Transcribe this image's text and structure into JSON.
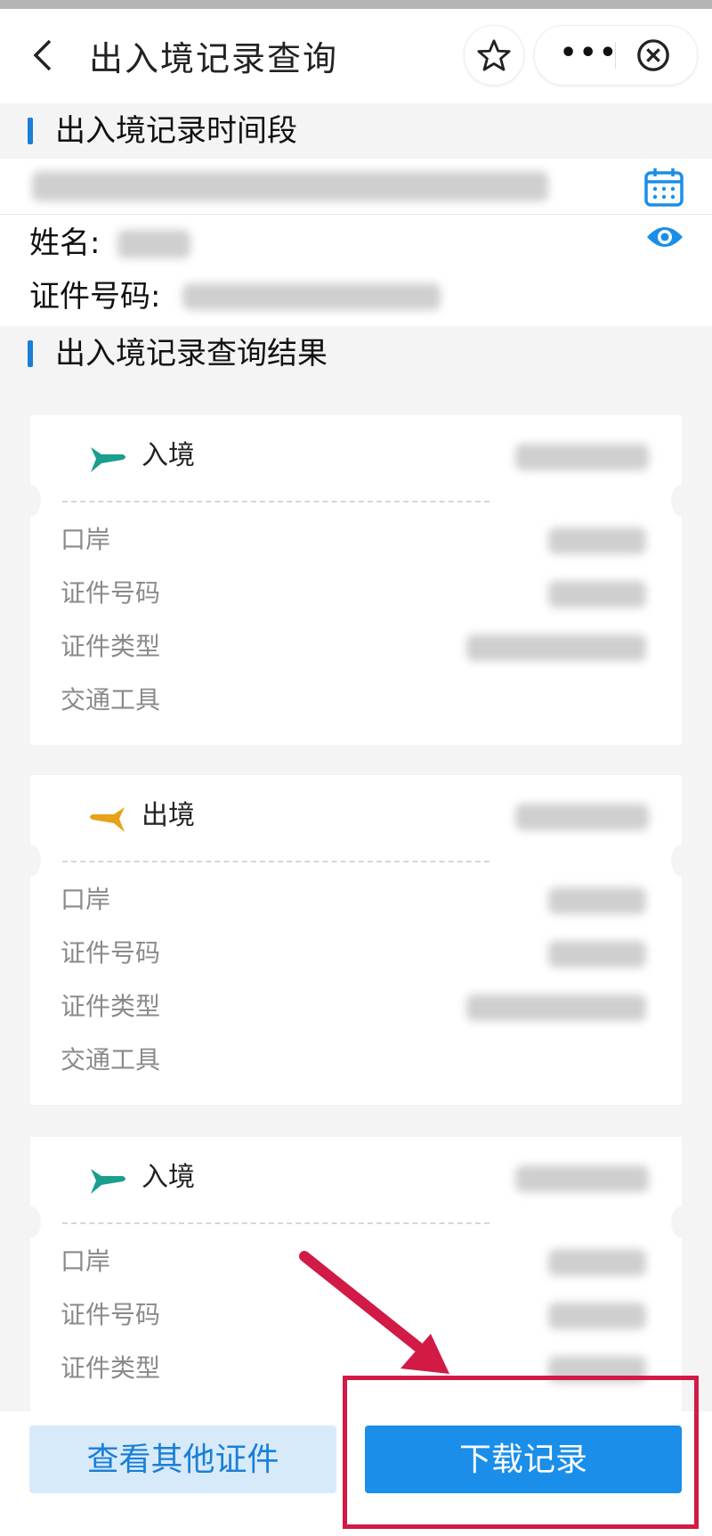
{
  "header": {
    "title": "出入境记录查询"
  },
  "period_section": {
    "title": "出入境记录时间段"
  },
  "person": {
    "name_label": "姓名:",
    "id_label": "证件号码:"
  },
  "results_section": {
    "title": "出入境记录查询结果"
  },
  "records": [
    {
      "type": "入境",
      "direction": "entry"
    },
    {
      "type": "出境",
      "direction": "exit"
    },
    {
      "type": "入境",
      "direction": "entry"
    }
  ],
  "field_labels": {
    "port": "口岸",
    "id_no": "证件号码",
    "id_type": "证件类型",
    "transport": "交通工具"
  },
  "buttons": {
    "other_docs": "查看其他证件",
    "download": "下载记录"
  },
  "colors": {
    "accent": "#1a8ee8",
    "entry_plane": "#1a9e8e",
    "exit_plane": "#e8a21a",
    "highlight": "#d11a46"
  }
}
